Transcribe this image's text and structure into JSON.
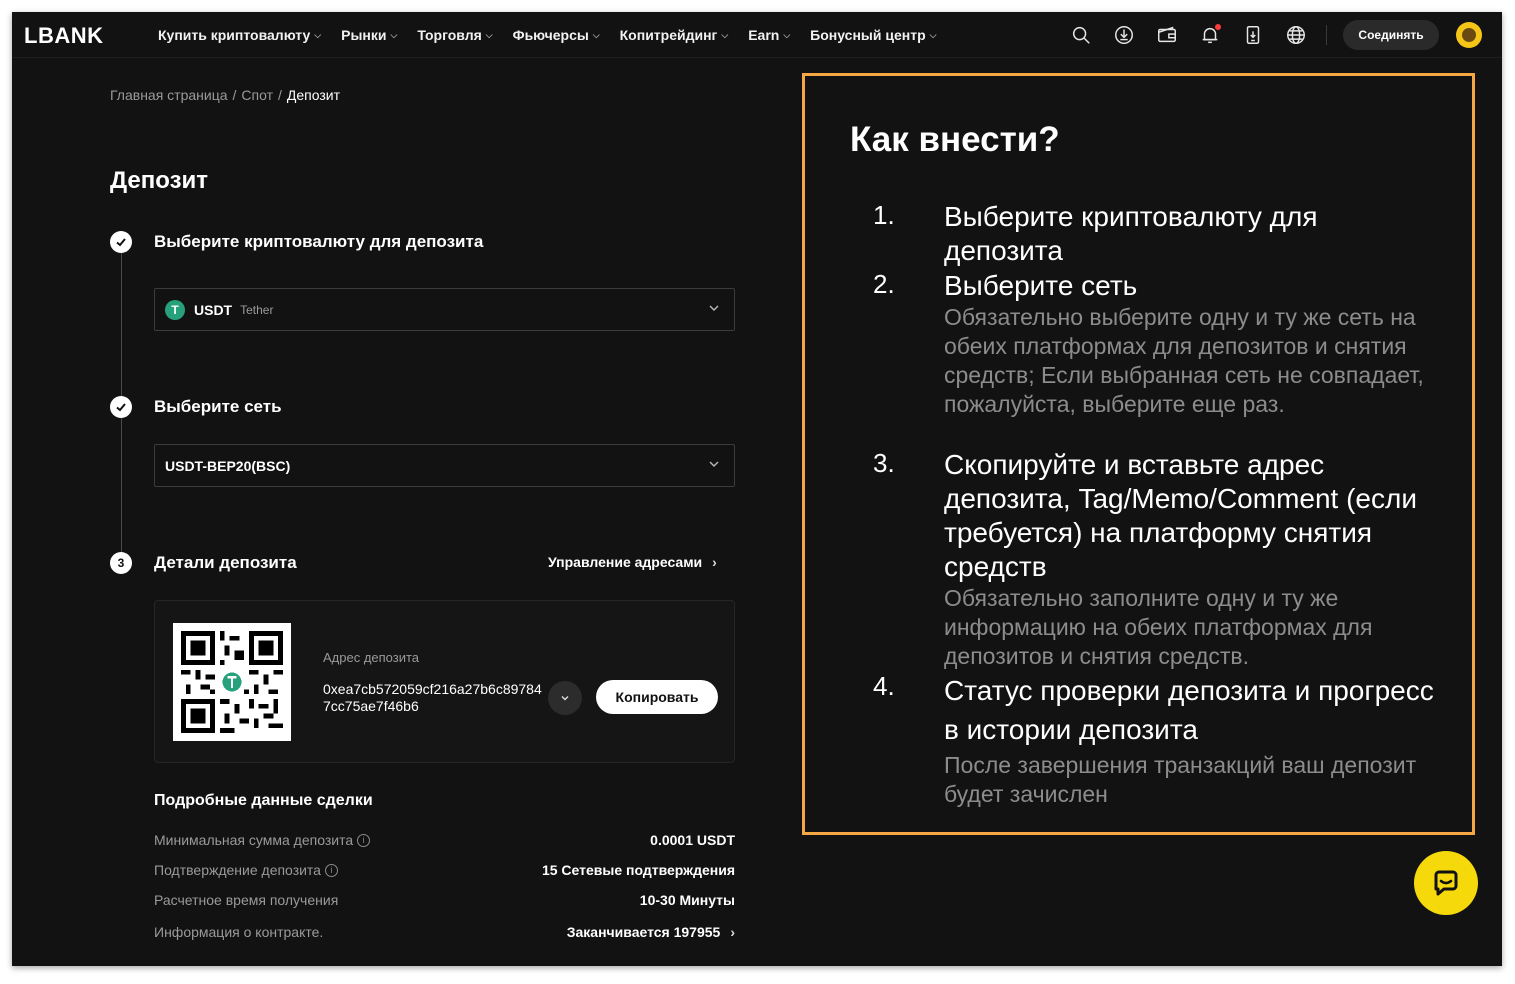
{
  "header": {
    "logo": "LBANK",
    "nav": [
      {
        "label": "Купить криптовалюту",
        "dropdown": true
      },
      {
        "label": "Рынки",
        "dropdown": true
      },
      {
        "label": "Торговля",
        "dropdown": true
      },
      {
        "label": "Фьючерсы",
        "dropdown": true
      },
      {
        "label": "Копитрейдинг",
        "dropdown": true
      },
      {
        "label": "Earn",
        "dropdown": true
      },
      {
        "label": "Бонусный центр",
        "dropdown": true
      }
    ],
    "icons": [
      "search-icon",
      "download-icon",
      "wallet-icon",
      "bell-icon",
      "app-download-icon",
      "globe-icon"
    ],
    "connect_label": "Соединять"
  },
  "breadcrumb": {
    "home": "Главная страница",
    "spot": "Спот",
    "current": "Депозит",
    "separator": "/"
  },
  "page_title": "Депозит",
  "steps": {
    "step1": {
      "title": "Выберите криптовалюту для депозита",
      "done": true
    },
    "step2": {
      "title": "Выберите сеть",
      "done": true
    },
    "step3": {
      "title": "Детали депозита",
      "number": "3"
    }
  },
  "coin_select": {
    "symbol": "USDT",
    "name": "Tether",
    "icon_letter": "T"
  },
  "network_select": {
    "value": "USDT-BEP20(BSC)"
  },
  "manage_addresses": "Управление адресами",
  "deposit_address": {
    "label": "Адрес депозита",
    "value": "0xea7cb572059cf216a27b6c897847cc75ae7f46b6",
    "copy_label": "Копировать"
  },
  "transaction_details": {
    "title": "Подробные данные сделки",
    "rows": [
      {
        "label": "Минимальная сумма депозита",
        "value": "0.0001 USDT",
        "info": true
      },
      {
        "label": "Подтверждение депозита",
        "value": "15 Сетевые подтверждения",
        "info": true
      },
      {
        "label": "Расчетное время получения",
        "value": "10-30 Минуты",
        "info": false
      },
      {
        "label": "Информация о контракте.",
        "value": "Заканчивается 197955",
        "info": false,
        "link": true
      }
    ]
  },
  "how_to": {
    "title": "Как внести?",
    "items": [
      {
        "num": "1.",
        "head": "Выберите криптовалюту для депозита",
        "desc": ""
      },
      {
        "num": "2.",
        "head": "Выберите сеть",
        "desc": "Обязательно выберите одну и ту же сеть на обеих платформах для депозитов и снятия средств; Если выбранная сеть не совпадает, пожалуйста, выберите еще раз."
      },
      {
        "num": "3.",
        "head": "Скопируйте и вставьте адрес депозита, Tag/Memo/Comment (если требуется) на платформу снятия средств",
        "desc": "Обязательно заполните одну и ту же информацию на обеих платформах для депозитов и снятия средств."
      },
      {
        "num": "4.",
        "head": "Статус проверки депозита и прогресс в истории депозита",
        "desc": "После завершения транзакций ваш депозит будет зачислен"
      }
    ],
    "border_color": "#f4a742"
  },
  "colors": {
    "background": "#121212",
    "accent": "#f5d90a",
    "tether": "#26a17b"
  }
}
